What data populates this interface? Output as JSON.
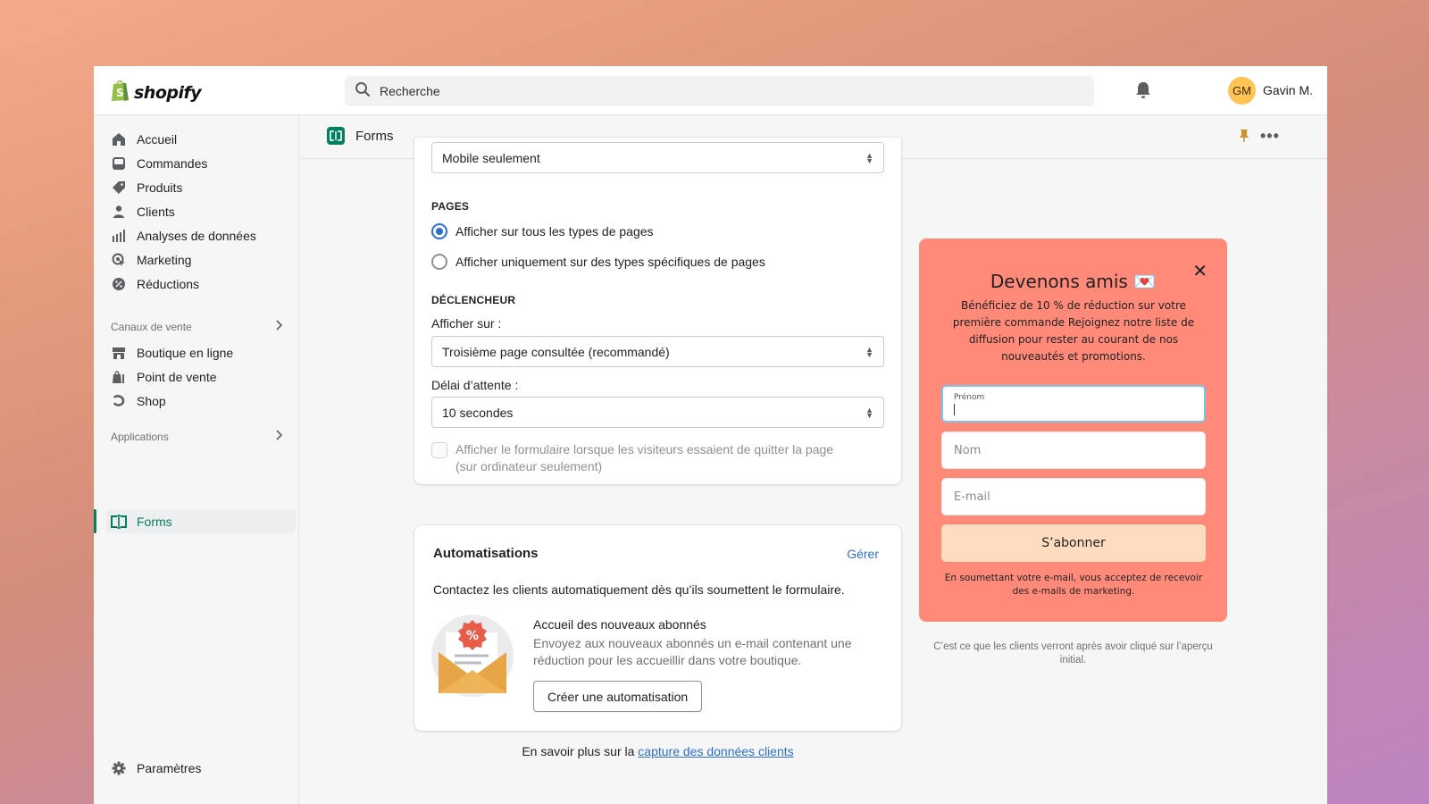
{
  "topbar": {
    "logo_text": "shopify",
    "search_placeholder": "Recherche",
    "user_initials": "GM",
    "user_name": "Gavin M."
  },
  "sidebar": {
    "items": [
      {
        "label": "Accueil",
        "icon": "home-icon"
      },
      {
        "label": "Commandes",
        "icon": "orders-icon"
      },
      {
        "label": "Produits",
        "icon": "tag-icon"
      },
      {
        "label": "Clients",
        "icon": "person-icon"
      },
      {
        "label": "Analyses de données",
        "icon": "analytics-icon"
      },
      {
        "label": "Marketing",
        "icon": "marketing-icon"
      },
      {
        "label": "Réductions",
        "icon": "discount-icon"
      }
    ],
    "sales_channels": {
      "title": "Canaux de vente",
      "items": [
        {
          "label": "Boutique en ligne",
          "icon": "store-icon"
        },
        {
          "label": "Point de vente",
          "icon": "pos-icon"
        },
        {
          "label": "Shop",
          "icon": "shop-icon"
        }
      ]
    },
    "apps": {
      "title": "Applications",
      "items": [
        {
          "label": "Forms",
          "icon": "forms-icon",
          "active": true
        }
      ]
    },
    "settings_label": "Paramètres"
  },
  "header": {
    "app_title": "Forms"
  },
  "settings_card": {
    "device_select_value": "Mobile seulement",
    "pages_title": "PAGES",
    "pages_options": [
      {
        "label": "Afficher sur tous les types de pages",
        "checked": true
      },
      {
        "label": "Afficher uniquement sur des types spécifiques de pages",
        "checked": false
      }
    ],
    "trigger_title": "DÉCLENCHEUR",
    "show_on_label": "Afficher sur :",
    "show_on_value": "Troisième page consultée (recommandé)",
    "delay_label": "Délai d’attente :",
    "delay_value": "10 secondes",
    "exit_intent_label": "Afficher le formulaire lorsque les visiteurs essaient de quitter la page",
    "exit_intent_sublabel": "(sur ordinateur seulement)",
    "exit_intent_checked": false
  },
  "automations_card": {
    "title": "Automatisations",
    "manage_label": "Gérer",
    "description": "Contactez les clients automatiquement dès qu’ils soumettent le formulaire.",
    "item_title": "Accueil des nouveaux abonnés",
    "item_description": "Envoyez aux nouveaux abonnés un e-mail contenant une réduction pour les accueillir dans votre boutique.",
    "create_button": "Créer une automatisation"
  },
  "footer": {
    "prefix": "En savoir plus sur la ",
    "link_text": "capture des données clients"
  },
  "preview": {
    "title": "Devenons amis 💌",
    "body": "Bénéficiez de 10 % de réduction sur votre première commande Rejoignez notre liste de diffusion pour rester au courant de nos nouveautés et promotions.",
    "first_name_label": "Prénom",
    "last_name_placeholder": "Nom",
    "email_placeholder": "E-mail",
    "subscribe_button": "S’abonner",
    "legal": "En soumettant votre e-mail, vous acceptez de recevoir des e-mails de marketing.",
    "caption": "C’est ce que les clients verront après avoir cliqué sur l’aperçu initial.",
    "background_color": "#ff8a7a",
    "button_color": "#fddcc0"
  }
}
